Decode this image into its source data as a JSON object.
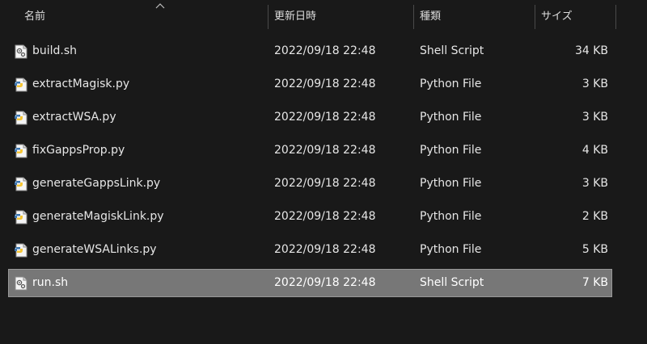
{
  "columns": {
    "name": "名前",
    "date": "更新日時",
    "type": "種類",
    "size": "サイズ"
  },
  "files": [
    {
      "name": "build.sh",
      "date": "2022/09/18 22:48",
      "type": "Shell Script",
      "size": "34 KB",
      "icon": "shell-script-icon",
      "selected": false
    },
    {
      "name": "extractMagisk.py",
      "date": "2022/09/18 22:48",
      "type": "Python File",
      "size": "3 KB",
      "icon": "python-file-icon",
      "selected": false
    },
    {
      "name": "extractWSA.py",
      "date": "2022/09/18 22:48",
      "type": "Python File",
      "size": "3 KB",
      "icon": "python-file-icon",
      "selected": false
    },
    {
      "name": "fixGappsProp.py",
      "date": "2022/09/18 22:48",
      "type": "Python File",
      "size": "4 KB",
      "icon": "python-file-icon",
      "selected": false
    },
    {
      "name": "generateGappsLink.py",
      "date": "2022/09/18 22:48",
      "type": "Python File",
      "size": "3 KB",
      "icon": "python-file-icon",
      "selected": false
    },
    {
      "name": "generateMagiskLink.py",
      "date": "2022/09/18 22:48",
      "type": "Python File",
      "size": "2 KB",
      "icon": "python-file-icon",
      "selected": false
    },
    {
      "name": "generateWSALinks.py",
      "date": "2022/09/18 22:48",
      "type": "Python File",
      "size": "5 KB",
      "icon": "python-file-icon",
      "selected": false
    },
    {
      "name": "run.sh",
      "date": "2022/09/18 22:48",
      "type": "Shell Script",
      "size": "7 KB",
      "icon": "shell-script-icon",
      "selected": true
    }
  ],
  "colors": {
    "background": "#191919",
    "selection": "#777777",
    "text": "#e6e6e6"
  }
}
